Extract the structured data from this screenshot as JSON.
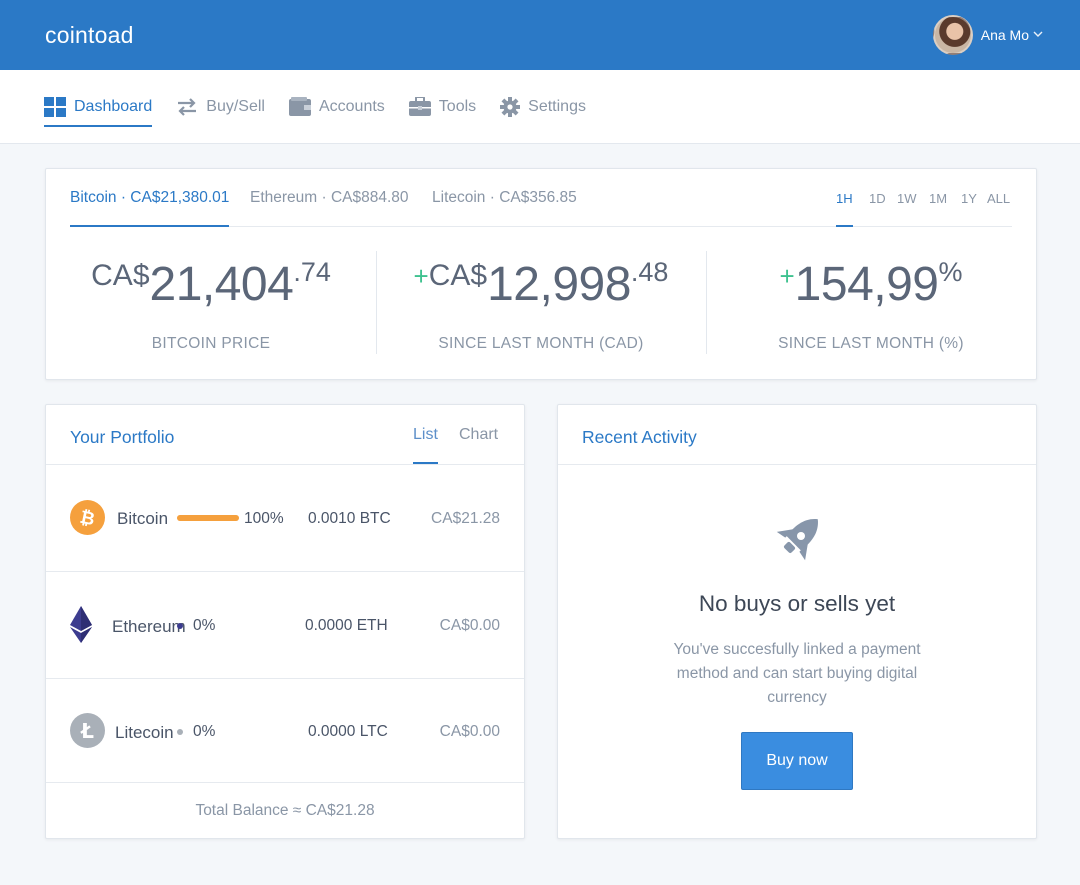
{
  "app": {
    "brand": "cointoad"
  },
  "user": {
    "name": "Ana Mo"
  },
  "nav": [
    {
      "label": "Dashboard",
      "icon": "dashboard-grid-icon",
      "active": true
    },
    {
      "label": "Buy/Sell",
      "icon": "swap-arrows-icon",
      "active": false
    },
    {
      "label": "Accounts",
      "icon": "wallet-icon",
      "active": false
    },
    {
      "label": "Tools",
      "icon": "briefcase-icon",
      "active": false
    },
    {
      "label": "Settings",
      "icon": "gear-icon",
      "active": false
    }
  ],
  "prices": {
    "coin_tabs": [
      {
        "label": "Bitcoin · CA$21,380.01",
        "active": true
      },
      {
        "label": "Ethereum · CA$884.80",
        "active": false
      },
      {
        "label": "Litecoin · CA$356.85",
        "active": false
      }
    ],
    "ranges": [
      "1H",
      "1D",
      "1W",
      "1M",
      "1Y",
      "ALL"
    ],
    "active_range": "1H",
    "stats": [
      {
        "sign": "",
        "prefix": "CA$",
        "main": "21,404",
        "sup": ".74",
        "label": "BITCOIN PRICE"
      },
      {
        "sign": "+",
        "prefix": "CA$",
        "main": "12,998",
        "sup": ".48",
        "label": "SINCE LAST MONTH (CAD)"
      },
      {
        "sign": "+",
        "prefix": "",
        "main": "154,99",
        "sup": "%",
        "label": "SINCE LAST MONTH (%)"
      }
    ]
  },
  "portfolio": {
    "title": "Your Portfolio",
    "view_tabs": [
      "List",
      "Chart"
    ],
    "active_view": "List",
    "rows": [
      {
        "name": "Bitcoin",
        "percent": "100%",
        "share": 1.0,
        "amount": "0.0010 BTC",
        "value": "CA$21.28",
        "color": "#f5a03d",
        "icon": "bitcoin-icon"
      },
      {
        "name": "Ethereum",
        "percent": "0%",
        "share": 0.0,
        "amount": "0.0000 ETH",
        "value": "CA$0.00",
        "color": "#3c3c8f",
        "icon": "ethereum-icon"
      },
      {
        "name": "Litecoin",
        "percent": "0%",
        "share": 0.0,
        "amount": "0.0000 LTC",
        "value": "CA$0.00",
        "color": "#a9b0b8",
        "icon": "litecoin-icon"
      }
    ],
    "total": "Total Balance ≈ CA$21.28"
  },
  "activity": {
    "title": "Recent Activity",
    "empty_title": "No buys or sells yet",
    "empty_text": "You've succesfully linked a payment method and can start buying digital currency",
    "button": "Buy now"
  },
  "colors": {
    "primary": "#2b79c6",
    "positive": "#3ec28f",
    "bitcoin": "#f5a03d",
    "ethereum": "#3c3c8f",
    "litecoin": "#a9b0b8"
  }
}
